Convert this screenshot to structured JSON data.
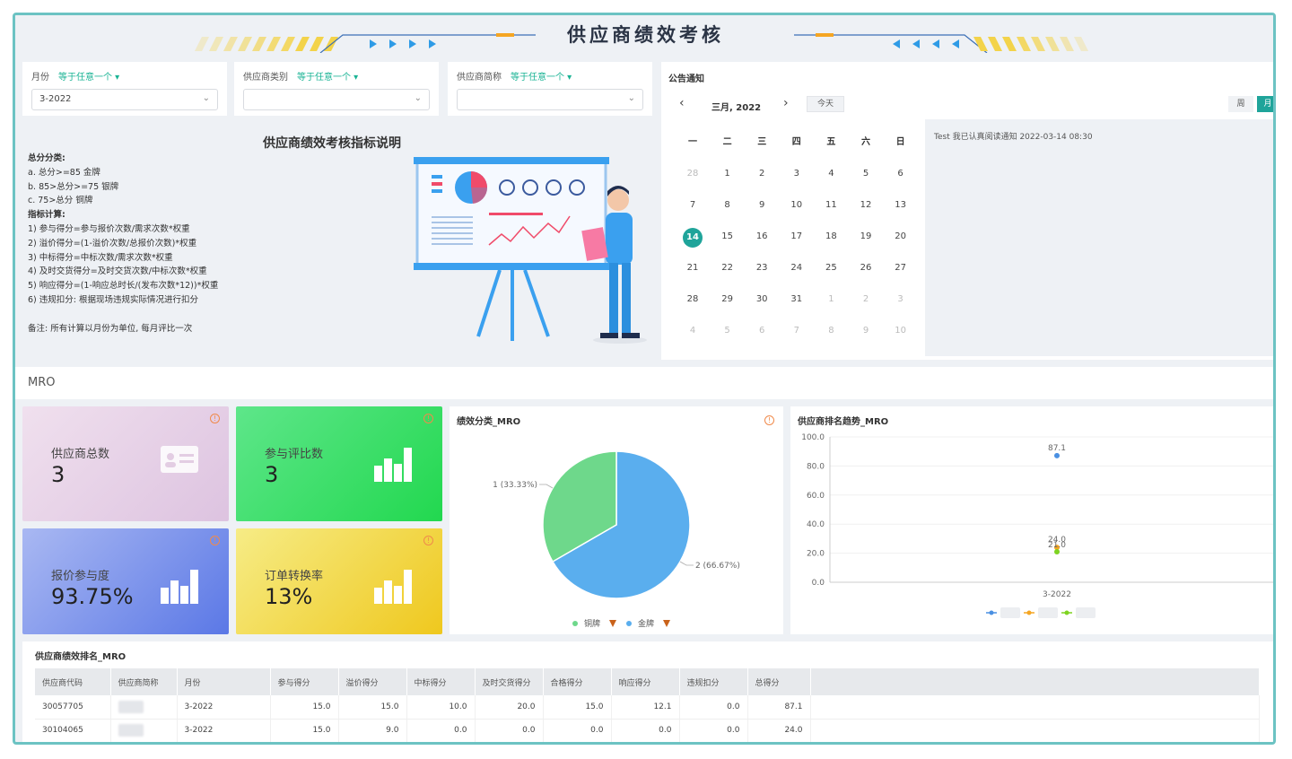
{
  "header": {
    "title": "供应商绩效考核"
  },
  "filters": [
    {
      "label": "月份",
      "cond": "等于任意一个",
      "value": "3-2022"
    },
    {
      "label": "供应商类别",
      "cond": "等于任意一个",
      "value": ""
    },
    {
      "label": "供应商简称",
      "cond": "等于任意一个",
      "value": ""
    }
  ],
  "description": {
    "title": "供应商绩效考核指标说明",
    "lines": [
      "总分分类:",
      "a.       总分>=85     金牌",
      "b.   85>总分>=75    银牌",
      "c.   75>总分           铜牌",
      "指标计算:",
      "1)  参与得分=参与报价次数/需求次数*权重",
      "2)  溢价得分=(1-溢价次数/总报价次数)*权重",
      "3)  中标得分=中标次数/需求次数*权重",
      "4)  及时交货得分=及时交货次数/中标次数*权重",
      "5)  响应得分=(1-响应总时长/(发布次数*12))*权重",
      "6)  违规扣分: 根据现场违规实际情况进行扣分",
      "",
      "备注: 所有计算以月份为单位, 每月评比一次"
    ]
  },
  "calendar": {
    "heading": "公告通知",
    "month_label": "三月, 2022",
    "today_label": "今天",
    "view_week": "周",
    "view_month": "月",
    "weekdays": [
      "一",
      "二",
      "三",
      "四",
      "五",
      "六",
      "日"
    ],
    "weeks": [
      [
        "28",
        "1",
        "2",
        "3",
        "4",
        "5",
        "6"
      ],
      [
        "7",
        "8",
        "9",
        "10",
        "11",
        "12",
        "13"
      ],
      [
        "14",
        "15",
        "16",
        "17",
        "18",
        "19",
        "20"
      ],
      [
        "21",
        "22",
        "23",
        "24",
        "25",
        "26",
        "27"
      ],
      [
        "28",
        "29",
        "30",
        "31",
        "1",
        "2",
        "3"
      ],
      [
        "4",
        "5",
        "6",
        "7",
        "8",
        "9",
        "10"
      ]
    ],
    "today": "14",
    "notice": "Test 我已认真阅读通知 2022-03-14 08:30"
  },
  "section": {
    "label": "MRO"
  },
  "kpis": [
    {
      "label": "供应商总数",
      "value": "3"
    },
    {
      "label": "参与评比数",
      "value": "3"
    },
    {
      "label": "报价参与度",
      "value": "93.75%"
    },
    {
      "label": "订单转换率",
      "value": "13%"
    }
  ],
  "colors": {
    "accent": "#1fa49a",
    "pie_blue": "#5aaeee",
    "pie_green": "#6ed88b"
  },
  "chart_data": [
    {
      "type": "pie",
      "title": "绩效分类_MRO",
      "slices": [
        {
          "label": "金牌",
          "value": 2,
          "text": "2 (66.67%)",
          "color": "#5aaeee"
        },
        {
          "label": "铜牌",
          "value": 1,
          "text": "1 (33.33%)",
          "color": "#6ed88b"
        }
      ],
      "legend": [
        "铜牌",
        "金牌"
      ]
    },
    {
      "type": "scatter",
      "title": "供应商排名趋势_MRO",
      "categories": [
        "3-2022"
      ],
      "yticks": [
        "100.0",
        "80.0",
        "60.0",
        "40.0",
        "20.0",
        "0.0"
      ],
      "ylim": [
        0,
        100
      ],
      "series": [
        {
          "value": 87.1,
          "label": "87.1",
          "color": "#4a90e2"
        },
        {
          "value": 24.0,
          "label": "24.0",
          "color": "#f5a623"
        },
        {
          "value": 21.0,
          "label": "21.0",
          "color": "#7ed321"
        }
      ]
    }
  ],
  "table": {
    "title": "供应商绩效排名_MRO",
    "headers": [
      "供应商代码",
      "供应商简称",
      "月份",
      "参与得分",
      "溢价得分",
      "中标得分",
      "及时交货得分",
      "合格得分",
      "响应得分",
      "违规扣分",
      "总得分"
    ],
    "rows": [
      [
        "30057705",
        "",
        "3-2022",
        "15.0",
        "15.0",
        "10.0",
        "20.0",
        "15.0",
        "12.1",
        "0.0",
        "87.1"
      ],
      [
        "30104065",
        "",
        "3-2022",
        "15.0",
        "9.0",
        "0.0",
        "0.0",
        "0.0",
        "0.0",
        "0.0",
        "24.0"
      ]
    ]
  }
}
